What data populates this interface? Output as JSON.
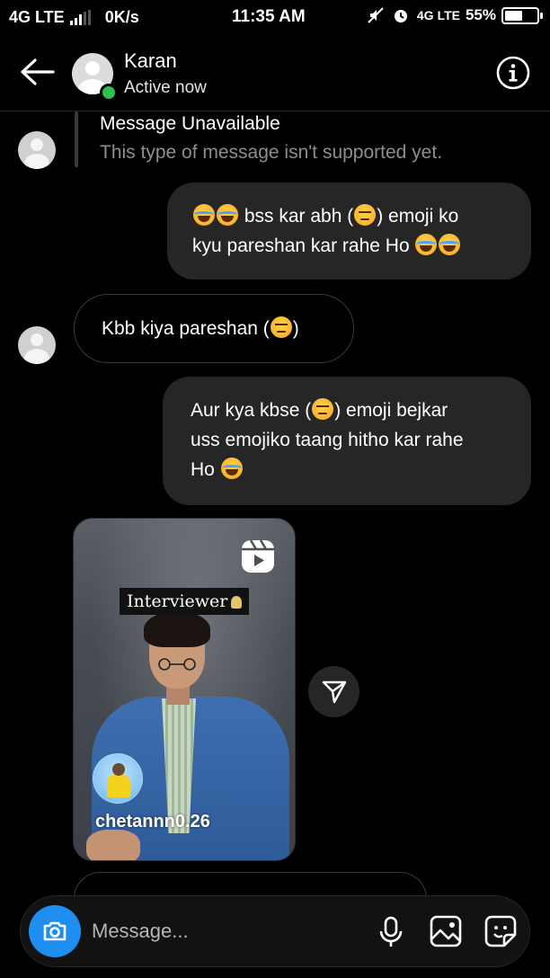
{
  "status_bar": {
    "network_left": "4G LTE",
    "speed": "0K/s",
    "time": "11:35 AM",
    "network_right_top": "4G",
    "network_right_bottom": "LTE",
    "battery": "55%",
    "battery_level": 0.55
  },
  "header": {
    "name": "Karan",
    "status": "Active now",
    "icons": [
      "back-arrow-icon",
      "info-icon"
    ]
  },
  "messages": {
    "unavailable_title": "Message Unavailable",
    "unavailable_text": "This type of message isn't supported yet.",
    "out1_line1": "bss kar abh (",
    "out1_line1b": ") emoji ko",
    "out1_line2": "kyu pareshan kar rahe Ho",
    "in1_text_a": "Kbb kiya pareshan (",
    "in1_text_b": ")",
    "out2_line1a": "Aur kya kbse (",
    "out2_line1b": ") emoji bejkar",
    "out2_line2": "uss emojiko taang hitho kar rahe",
    "out2_line3": "Ho"
  },
  "reel": {
    "overlay_label": "Interviewer",
    "username": "chetannn0.26"
  },
  "composer": {
    "placeholder": "Message...",
    "icons": [
      "camera-icon",
      "microphone-icon",
      "gallery-icon",
      "sticker-icon"
    ]
  },
  "colors": {
    "background": "#000000",
    "bubble": "#262626",
    "accent_blue": "#1f8ef1",
    "active_green": "#2ec04f",
    "muted_text": "#8e8e8e"
  }
}
